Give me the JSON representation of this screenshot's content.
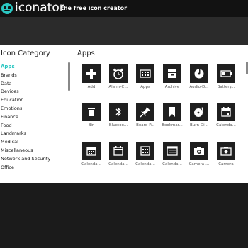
{
  "header": {
    "brand": "iconator",
    "tagline": "the free icon creator"
  },
  "colors": {
    "accent": "#2bc7c2",
    "tile": "#1f1f1f",
    "topbar": "#121212"
  },
  "sidebar": {
    "title": "Icon Category",
    "items": [
      {
        "label": "Apps",
        "active": true
      },
      {
        "label": "Brands"
      },
      {
        "label": "Data"
      },
      {
        "label": "Devices"
      },
      {
        "label": "Education"
      },
      {
        "label": "Emotions"
      },
      {
        "label": "Finance"
      },
      {
        "label": "Food"
      },
      {
        "label": "Landmarks"
      },
      {
        "label": "Medical"
      },
      {
        "label": "Miscellaneous"
      },
      {
        "label": "Network and Security"
      },
      {
        "label": "Office"
      }
    ]
  },
  "main": {
    "title": "Apps",
    "icons": [
      {
        "label": "Add",
        "icon": "plus-icon"
      },
      {
        "label": "Alarm-C...",
        "icon": "alarm-clock-icon"
      },
      {
        "label": "Apps",
        "icon": "apps-icon"
      },
      {
        "label": "Archive",
        "icon": "archive-icon"
      },
      {
        "label": "Audio-D...",
        "icon": "audio-disc-icon"
      },
      {
        "label": "Battery...",
        "icon": "battery-icon"
      },
      {
        "label": "Bin",
        "icon": "bin-icon"
      },
      {
        "label": "Bluetoo...",
        "icon": "bluetooth-icon"
      },
      {
        "label": "Board-P...",
        "icon": "board-pin-icon"
      },
      {
        "label": "Bookmar...",
        "icon": "bookmark-icon"
      },
      {
        "label": "Burn-Di...",
        "icon": "burn-disc-icon"
      },
      {
        "label": "Calenda...",
        "icon": "calendar-icon"
      },
      {
        "label": "Calenda...",
        "icon": "calendar-grid-icon"
      },
      {
        "label": "Calenda...",
        "icon": "calendar-blank-icon"
      },
      {
        "label": "Calenda...",
        "icon": "calendar-full-icon"
      },
      {
        "label": "Calenda...",
        "icon": "calendar-list-icon"
      },
      {
        "label": "Camera-...",
        "icon": "camera-alt-icon"
      },
      {
        "label": "Camera",
        "icon": "camera-icon"
      }
    ]
  }
}
